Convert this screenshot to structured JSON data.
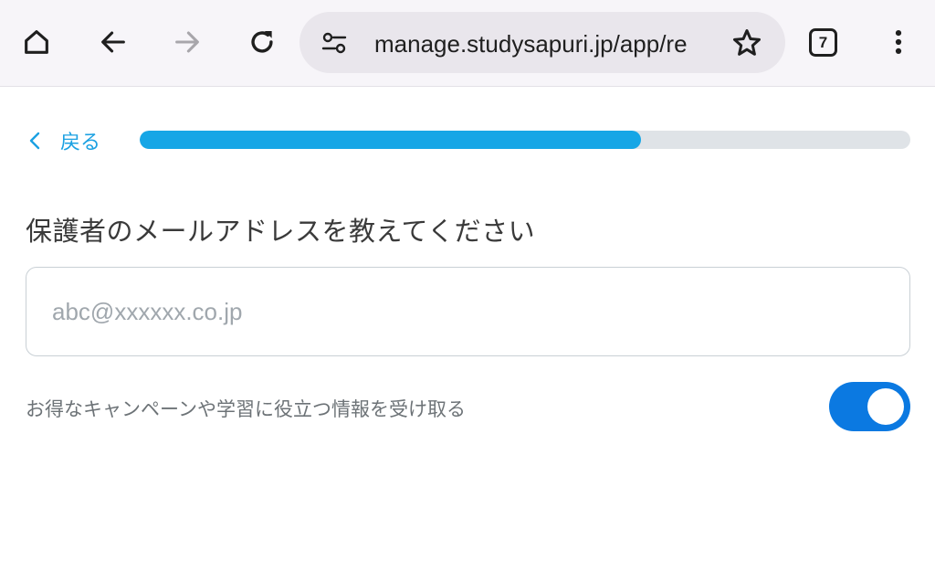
{
  "browser": {
    "url": "manage.studysapuri.jp/app/re",
    "tab_count": "7",
    "icons": {
      "home": "home-icon",
      "back": "arrow-left-icon",
      "forward": "arrow-right-icon",
      "reload": "reload-icon",
      "site_info": "tune-icon",
      "bookmark": "star-icon",
      "menu": "more-vert-icon"
    }
  },
  "page": {
    "back_label": "戻る",
    "progress_fraction": 0.65,
    "heading": "保護者のメールアドレスを教えてください",
    "email_placeholder": "abc@xxxxxx.co.jp",
    "email_value": "",
    "optin_label": "お得なキャンペーンや学習に役立つ情報を受け取る",
    "optin_enabled": true
  },
  "colors": {
    "accent": "#1ba1e2",
    "progress_fill": "#16a6e6",
    "progress_track": "#dfe3e7",
    "toggle_on": "#0b79e1"
  }
}
